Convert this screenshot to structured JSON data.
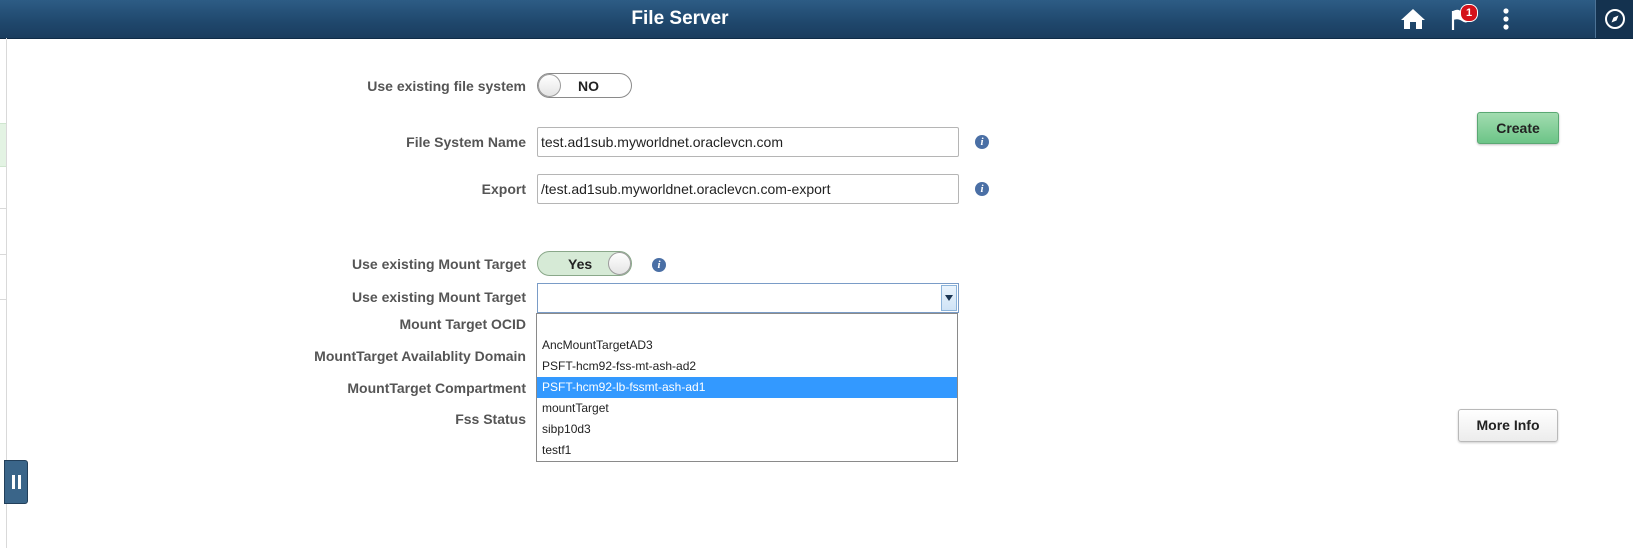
{
  "header": {
    "title": "File Server",
    "notification_count": "1",
    "icons": [
      "home-icon",
      "flag-icon",
      "kebab-menu-icon",
      "compass-icon"
    ]
  },
  "form": {
    "use_existing_fs": {
      "label": "Use existing file system",
      "value": "NO",
      "on": false
    },
    "fs_name": {
      "label": "File System Name",
      "value": "test.ad1sub.myworldnet.oraclevcn.com"
    },
    "export": {
      "label": "Export",
      "value": "/test.ad1sub.myworldnet.oraclevcn.com-export"
    },
    "use_existing_mt_toggle": {
      "label": "Use existing Mount Target",
      "value": "Yes",
      "on": true
    },
    "use_existing_mt_select": {
      "label": "Use existing Mount Target",
      "selected": "",
      "options": [
        "",
        "AncMountTargetAD3",
        "PSFT-hcm92-fss-mt-ash-ad2",
        "PSFT-hcm92-lb-fssmt-ash-ad1",
        "mountTarget",
        "sibp10d3",
        "testf1"
      ],
      "highlighted_index": 3
    },
    "mt_ocid": {
      "label": "Mount Target OCID"
    },
    "mt_ad": {
      "label": "MountTarget Availablity Domain"
    },
    "mt_compartment": {
      "label": "MountTarget Compartment"
    },
    "fss_status": {
      "label": "Fss Status"
    }
  },
  "buttons": {
    "create": "Create",
    "more_info": "More Info"
  },
  "colors": {
    "header_bg": "#1f476c",
    "create_button": "#6cc487",
    "toggle_on": "#d6ead6",
    "selected_option": "#3399ff"
  }
}
